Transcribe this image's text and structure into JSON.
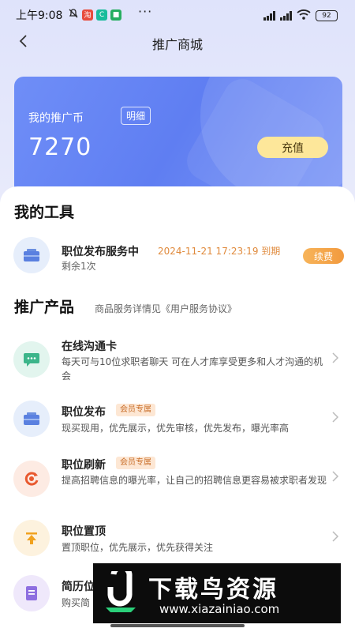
{
  "status_bar": {
    "time": "上午9:08",
    "dots": "···",
    "battery": "92"
  },
  "header": {
    "title": "推广商城"
  },
  "balance": {
    "label": "我的推广币",
    "detail_label": "明细",
    "value": "7270",
    "recharge_label": "充值"
  },
  "tools": {
    "title": "我的工具",
    "items": [
      {
        "name": "职位发布服务中",
        "expire": "2024-11-21 17:23:19 到期",
        "remain": "剩余1次",
        "action": "续费"
      }
    ]
  },
  "products": {
    "title": "推广产品",
    "subtitle": "商品服务详情见《用户服务协议》",
    "items": [
      {
        "name": "在线沟通卡",
        "desc": "每天可与10位求职者聊天 可在人才库享受更多和人才沟通的机会",
        "tag": ""
      },
      {
        "name": "职位发布",
        "desc": "现买现用，优先展示，优先审核，优先发布，曝光率高",
        "tag": "会员专属"
      },
      {
        "name": "职位刷新",
        "desc": "提高招聘信息的曝光率，让自己的招聘信息更容易被求职者发现",
        "tag": "会员专属"
      },
      {
        "name": "职位置顶",
        "desc": "置顶职位，优先展示，优先获得关注",
        "tag": ""
      },
      {
        "name": "简历位",
        "desc": "购买简",
        "tag": ""
      }
    ]
  },
  "watermark": {
    "title": "下载鸟资源",
    "url": "www.xiazainiao.com"
  }
}
